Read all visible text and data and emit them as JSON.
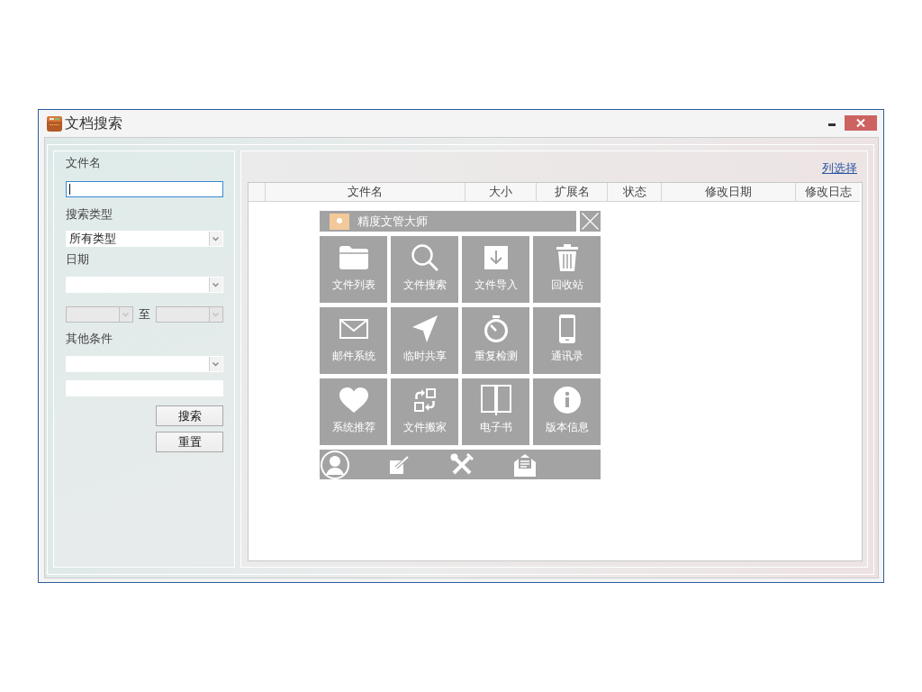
{
  "window": {
    "title": "文档搜索"
  },
  "search_panel": {
    "filename": {
      "label": "文件名",
      "focused": true
    },
    "search_type": {
      "label": "搜索类型",
      "value": "所有类型"
    },
    "date": {
      "label": "日期",
      "separator": "至",
      "range_disabled": true
    },
    "other_conditions": {
      "label": "其他条件"
    },
    "buttons": [
      "搜索",
      "重置"
    ]
  },
  "results": {
    "column_chooser": "列选择",
    "columns": [
      "文件名",
      "大小",
      "扩展名",
      "状态",
      "修改日期",
      "修改日志"
    ]
  },
  "launcher": {
    "title": "精度文管大师",
    "tiles": [
      {
        "kind": "folder",
        "label": "文件列表"
      },
      {
        "kind": "search",
        "label": "文件搜索"
      },
      {
        "kind": "download",
        "label": "文件导入"
      },
      {
        "kind": "trash",
        "label": "回收站"
      },
      {
        "kind": "envelope",
        "label": "邮件系统"
      },
      {
        "kind": "send",
        "label": "临时共享"
      },
      {
        "kind": "stopwatch",
        "label": "重复检测"
      },
      {
        "kind": "phone",
        "label": "通讯录"
      },
      {
        "kind": "heart",
        "label": "系统推荐"
      },
      {
        "kind": "swap",
        "label": "文件搬家"
      },
      {
        "kind": "book",
        "label": "电子书"
      },
      {
        "kind": "info",
        "label": "版本信息"
      }
    ]
  }
}
